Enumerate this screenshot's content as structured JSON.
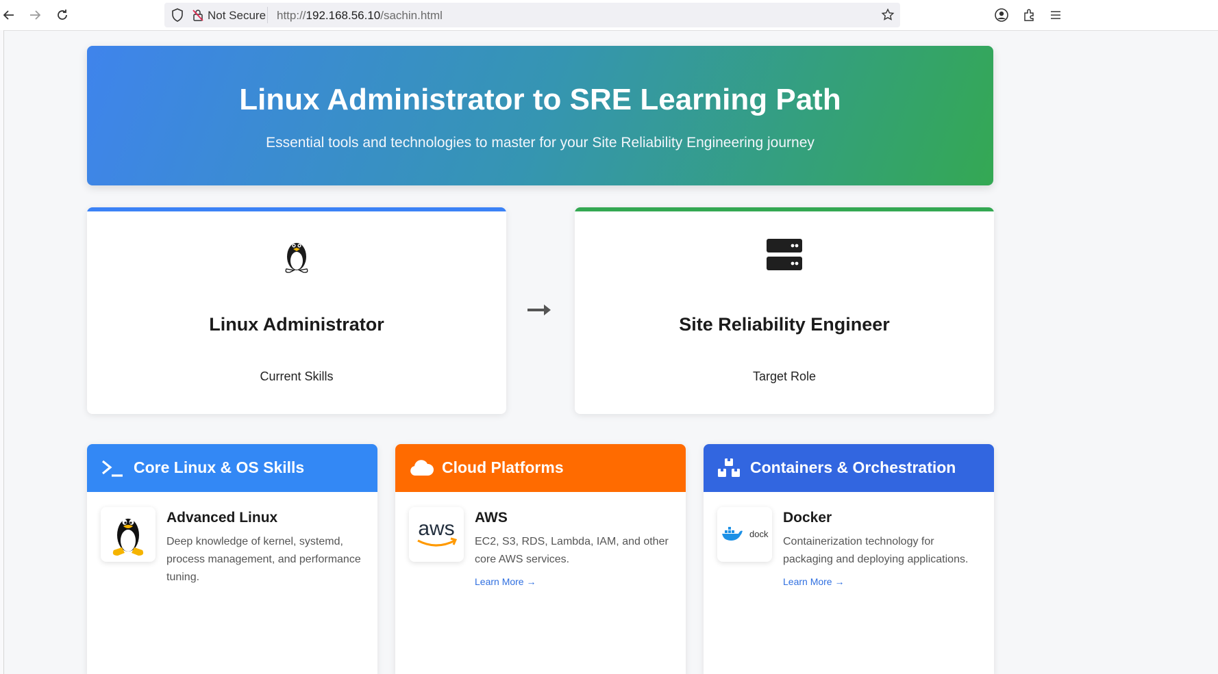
{
  "browser": {
    "security_label": "Not Secure",
    "url_scheme": "http://",
    "url_host": "192.168.56.10",
    "url_path": "/sachin.html"
  },
  "hero": {
    "title": "Linux Administrator to SRE Learning Path",
    "subtitle": "Essential tools and technologies to master for your Site Reliability Engineering journey"
  },
  "roles": [
    {
      "title": "Linux Administrator",
      "subtitle": "Current Skills",
      "icon": "linux-tux-icon",
      "accent": "#3b82f6"
    },
    {
      "title": "Site Reliability Engineer",
      "subtitle": "Target Role",
      "icon": "server-icon",
      "accent": "#34a853"
    }
  ],
  "categories": [
    {
      "title": "Core Linux & OS Skills",
      "icon": "terminal-icon",
      "color": "#3388f5",
      "item": {
        "title": "Advanced Linux",
        "desc": "Deep knowledge of kernel, systemd, process management, and performance tuning.",
        "logo": "linux-tux-icon",
        "link": ""
      }
    },
    {
      "title": "Cloud Platforms",
      "icon": "cloud-icon",
      "color": "#ff6b00",
      "item": {
        "title": "AWS",
        "desc": "EC2, S3, RDS, Lambda, IAM, and other core AWS services.",
        "logo": "aws-logo",
        "link": "Learn More →"
      }
    },
    {
      "title": "Containers & Orchestration",
      "icon": "cubes-icon",
      "color": "#3266e0",
      "item": {
        "title": "Docker",
        "desc": "Containerization technology for packaging and deploying applications.",
        "logo": "docker-logo",
        "link": "Learn More →"
      }
    }
  ]
}
